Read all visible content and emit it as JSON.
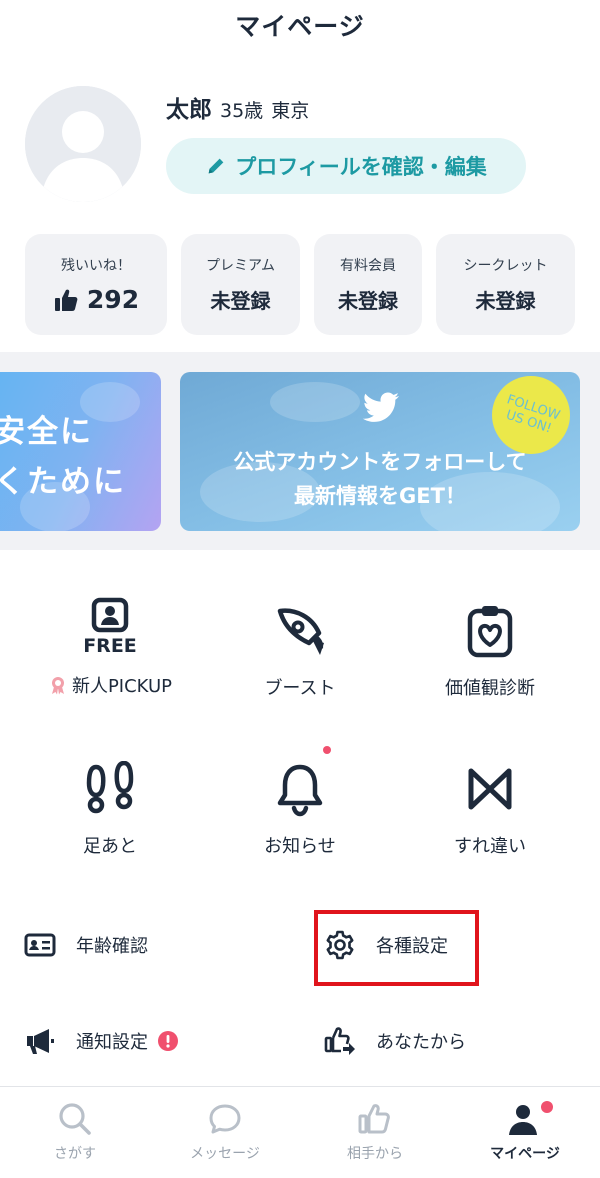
{
  "header": {
    "title": "マイページ"
  },
  "profile": {
    "name": "太郎",
    "age": "35歳",
    "location": "東京",
    "edit_button_label": "プロフィールを確認・編集"
  },
  "stats": [
    {
      "label": "残いいね！",
      "value": "292",
      "icon": "thumbs-up-icon"
    },
    {
      "label": "プレミアム",
      "value": "未登録"
    },
    {
      "label": "有料会員",
      "value": "未登録"
    },
    {
      "label": "シークレット",
      "value": "未登録"
    }
  ],
  "banners": {
    "left": {
      "line1": "安全に",
      "line2": "くために"
    },
    "right": {
      "line1": "公式アカウントをフォローして",
      "line2": "最新情報をGET！",
      "badge": "FOLLOW US ON!",
      "icon": "twitter-bird-icon"
    }
  },
  "features": [
    {
      "label": "新人PICKUP",
      "icon": "free-profile-icon",
      "icon_text": "FREE",
      "label_icon": "award-ribbon-icon"
    },
    {
      "label": "ブースト",
      "icon": "rocket-icon"
    },
    {
      "label": "価値観診断",
      "icon": "clipboard-heart-icon"
    },
    {
      "label": "足あと",
      "icon": "footprints-icon"
    },
    {
      "label": "お知らせ",
      "icon": "bell-icon",
      "badge_dot": true
    },
    {
      "label": "すれ違い",
      "icon": "crossing-paths-icon"
    }
  ],
  "settings": [
    {
      "label": "年齢確認",
      "icon": "id-card-icon"
    },
    {
      "label": "各種設定",
      "icon": "gear-icon",
      "highlighted": true
    },
    {
      "label": "通知設定",
      "icon": "megaphone-icon",
      "alert": true
    },
    {
      "label": "あなたから",
      "icon": "thumbs-up-arrow-icon"
    }
  ],
  "tabs": [
    {
      "label": "さがす",
      "icon": "search-icon",
      "active": false
    },
    {
      "label": "メッセージ",
      "icon": "speech-bubble-icon",
      "active": false
    },
    {
      "label": "相手から",
      "icon": "thumbs-up-icon",
      "active": false
    },
    {
      "label": "マイページ",
      "icon": "person-icon",
      "active": true
    }
  ],
  "colors": {
    "text": "#1e2a3b",
    "accent_teal": "#1d9aa3",
    "button_bg": "#e3f5f6",
    "card_bg": "#f1f2f5",
    "notification_red": "#f0506e",
    "highlight_red": "#e0141c",
    "tab_inactive": "#9aa3ae"
  }
}
